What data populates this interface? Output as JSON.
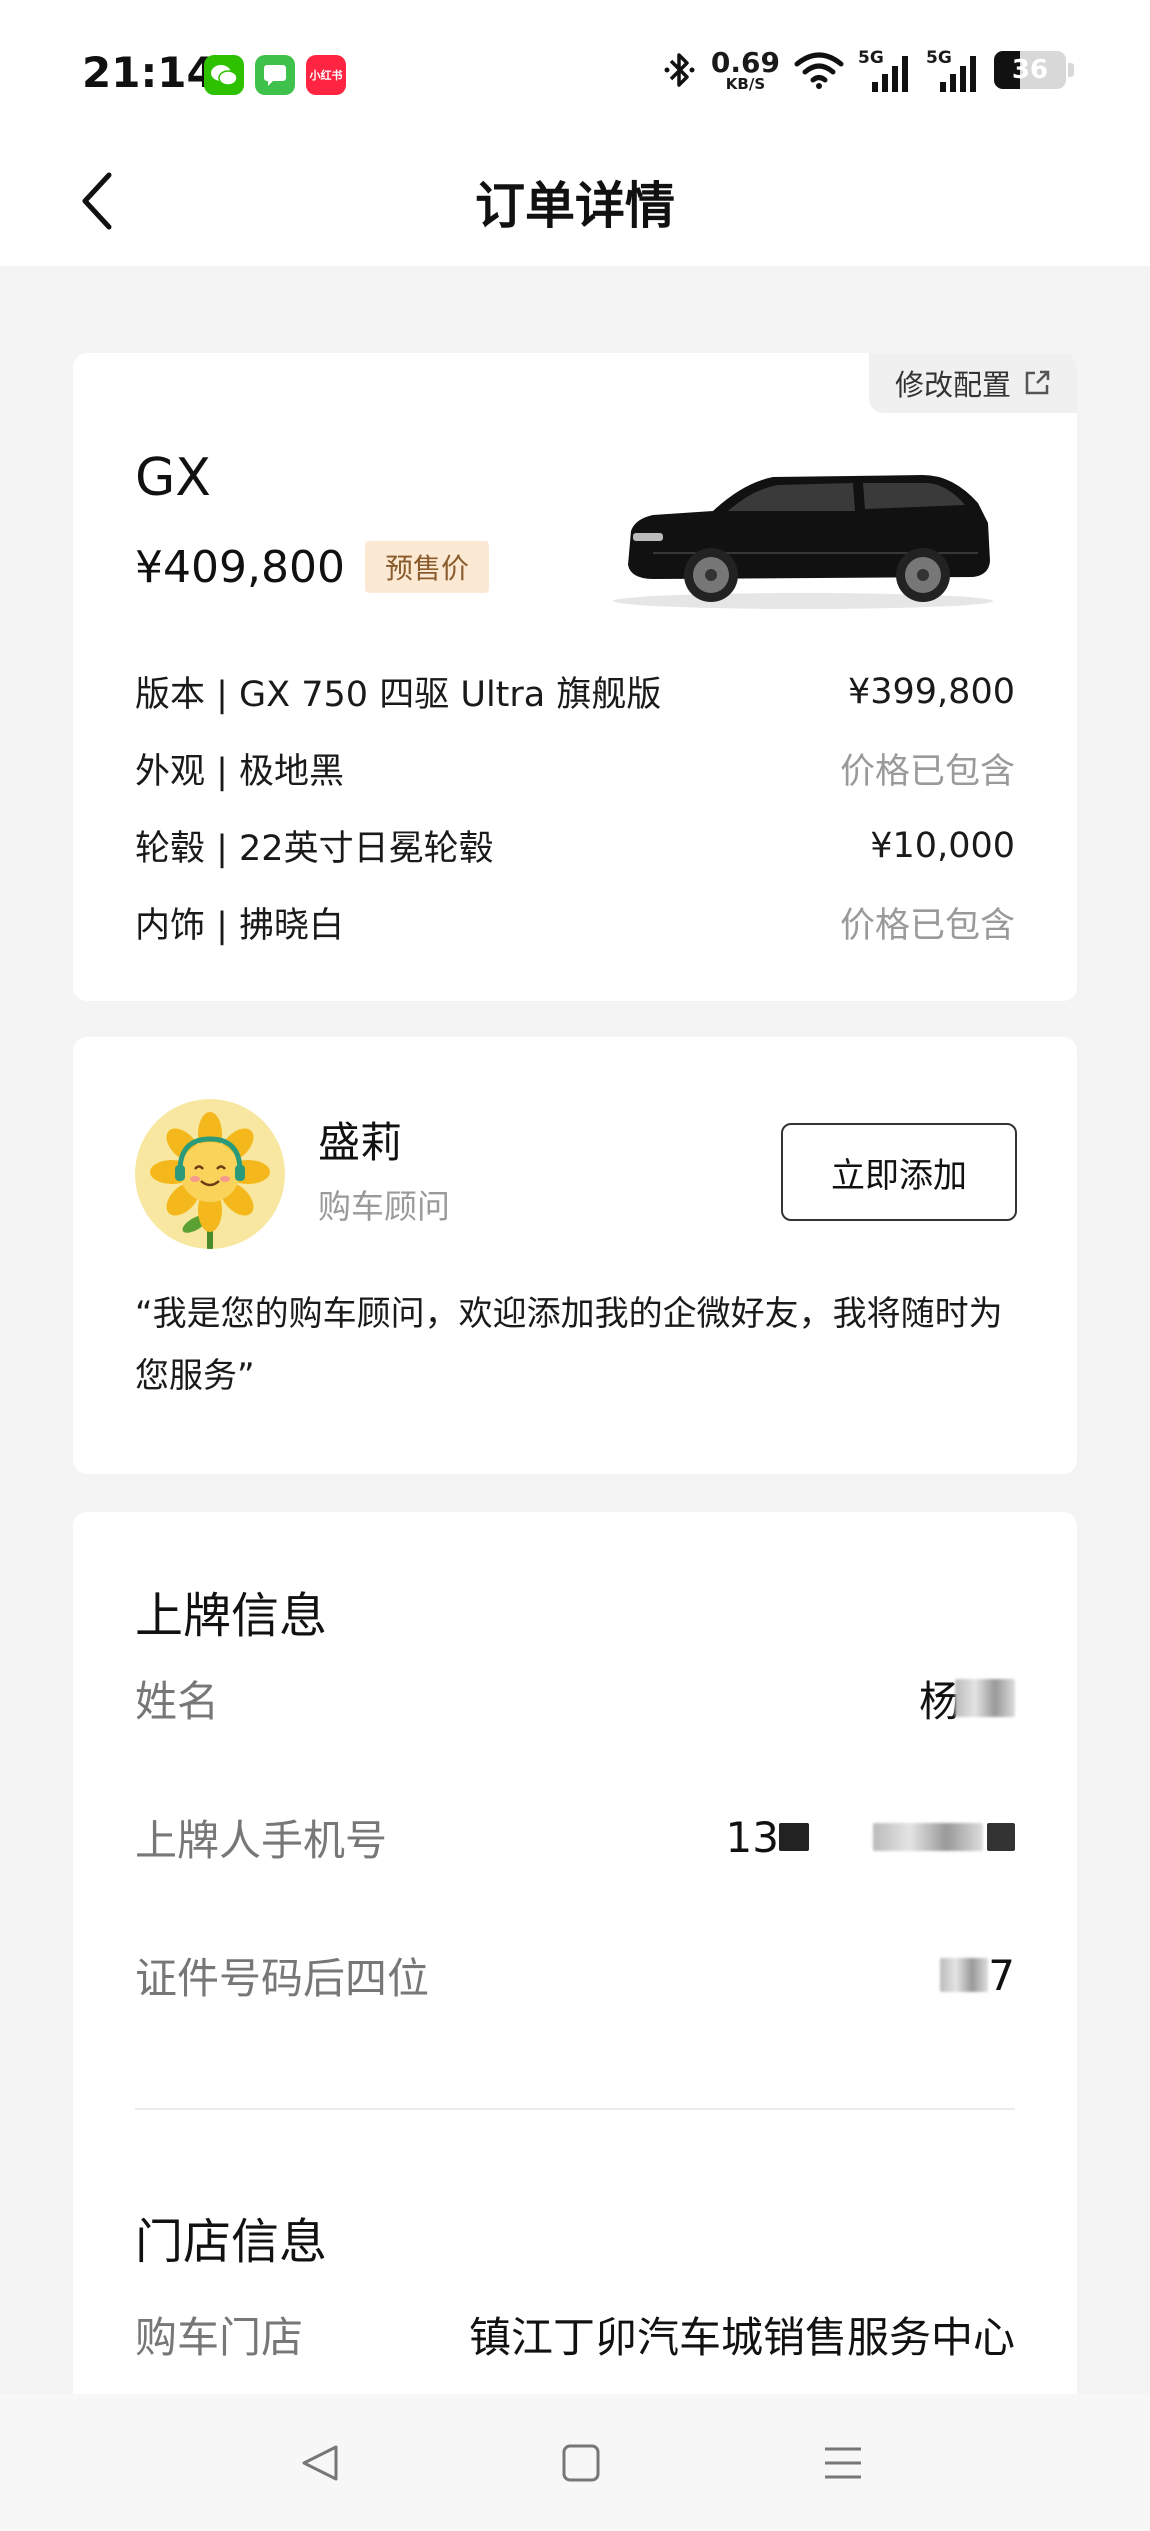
{
  "status_bar": {
    "time": "21:14",
    "app_icons": [
      "wechat-icon",
      "messages-icon",
      "xiaohongshu-icon"
    ],
    "xhs_label": "小红书",
    "net_speed_value": "0.69",
    "net_speed_unit": "KB/S",
    "signal1_label": "5G",
    "signal2_label": "5G",
    "battery_level": "36"
  },
  "header": {
    "title": "订单详情"
  },
  "order_card": {
    "modify_label": "修改配置",
    "model": "GX",
    "total_price": "¥409,800",
    "price_tag": "预售价",
    "specs": [
      {
        "label": "版本 | GX 750 四驱 Ultra 旗舰版",
        "value": "¥399,800",
        "muted": false
      },
      {
        "label": "外观 | 极地黑",
        "value": "价格已包含",
        "muted": true
      },
      {
        "label": "轮毂 | 22英寸日冕轮毂",
        "value": "¥10,000",
        "muted": false
      },
      {
        "label": "内饰 | 拂晓白",
        "value": "价格已包含",
        "muted": true
      }
    ]
  },
  "advisor_card": {
    "name": "盛莉",
    "role": "购车顾问",
    "add_button": "立即添加",
    "quote": "“我是您的购车顾问，欢迎添加我的企微好友，我将随时为您服务”"
  },
  "registration": {
    "title": "上牌信息",
    "name_label": "姓名",
    "name_value_visible": "杨",
    "phone_label": "上牌人手机号",
    "phone_value_visible": "13",
    "id_label": "证件号码后四位",
    "id_value_visible": "7"
  },
  "store": {
    "title": "门店信息",
    "store_label": "购车门店",
    "store_value": "镇江丁卯汽车城销售服务中心"
  },
  "colors": {
    "tag_bg": "#fbe9d3",
    "tag_text": "#8a5b2c",
    "page_bg": "#f4f4f4"
  }
}
